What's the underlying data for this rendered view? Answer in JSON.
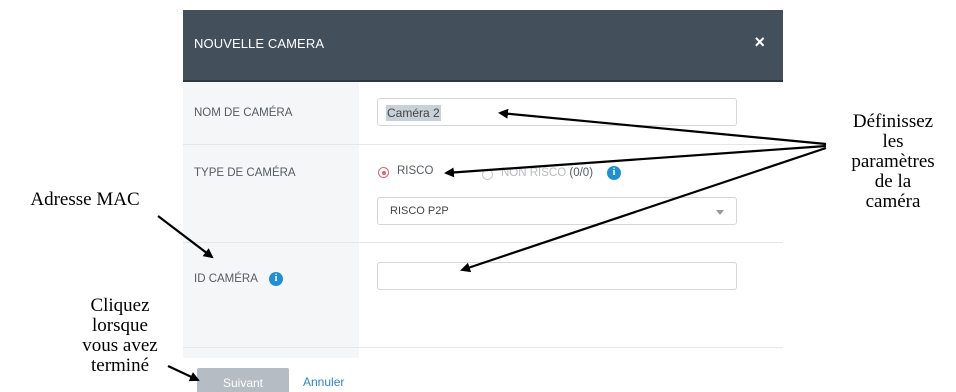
{
  "dialog": {
    "title": "NOUVELLE CAMERA",
    "close_glyph": "×"
  },
  "form": {
    "camera_name": {
      "label": "NOM DE CAMÉRA",
      "value": "Caméra 2"
    },
    "camera_type": {
      "label": "TYPE DE CAMÉRA",
      "options": [
        {
          "label": "RISCO",
          "selected": true
        },
        {
          "label": "NON RISCO",
          "count": "(0/0)",
          "selected": false
        }
      ],
      "select_value": "RISCO P2P"
    },
    "camera_id": {
      "label": "ID CAMÉRA",
      "value": ""
    },
    "info_glyph": "i"
  },
  "footer": {
    "next_label": "Suivant",
    "cancel_label": "Annuler"
  },
  "annotations": {
    "mac": "Adresse MAC",
    "params": [
      "Définissez",
      "les",
      "paramètres",
      "de la",
      "caméra"
    ],
    "click": [
      "Cliquez",
      "lorsque",
      "vous avez",
      "terminé"
    ]
  },
  "colors": {
    "header_bg": "#444f5c",
    "accent_radio": "#e2626a",
    "info_blue": "#1f8fd6",
    "link_blue": "#2a88c8"
  }
}
